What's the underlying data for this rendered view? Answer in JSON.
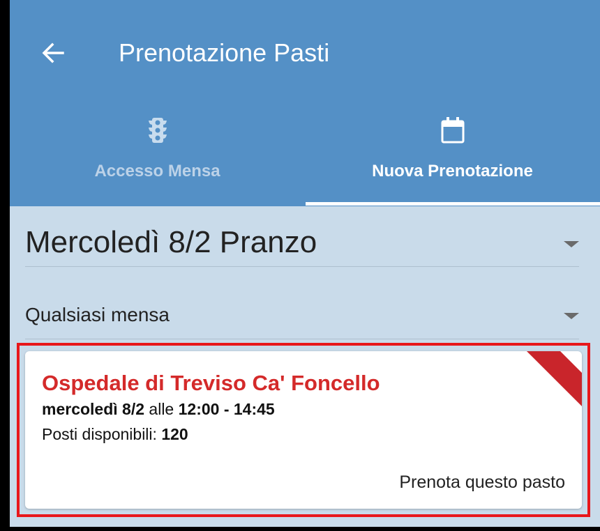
{
  "appbar": {
    "title": "Prenotazione Pasti",
    "back_icon": "arrow-left-icon",
    "background_color": "#5490c6"
  },
  "tabs": [
    {
      "label": "Accesso Mensa",
      "icon": "traffic-light-icon",
      "selected": false
    },
    {
      "label": "Nuova Prenotazione",
      "icon": "calendar-icon",
      "selected": true
    }
  ],
  "filters": {
    "meal": {
      "value": "Mercoledì 8/2 Pranzo"
    },
    "canteen": {
      "value": "Qualsiasi mensa"
    }
  },
  "meal_card": {
    "location": "Ospedale di Treviso Ca' Foncello",
    "day": "mercoledì 8/2",
    "time_connector": "alle",
    "time_range": "12:00 - 14:45",
    "seats_label": "Posti disponibili:",
    "seats_value": "120",
    "action_label": "Prenota questo pasto",
    "location_color": "#d42a2a",
    "ribbon_color": "#c9252b"
  }
}
